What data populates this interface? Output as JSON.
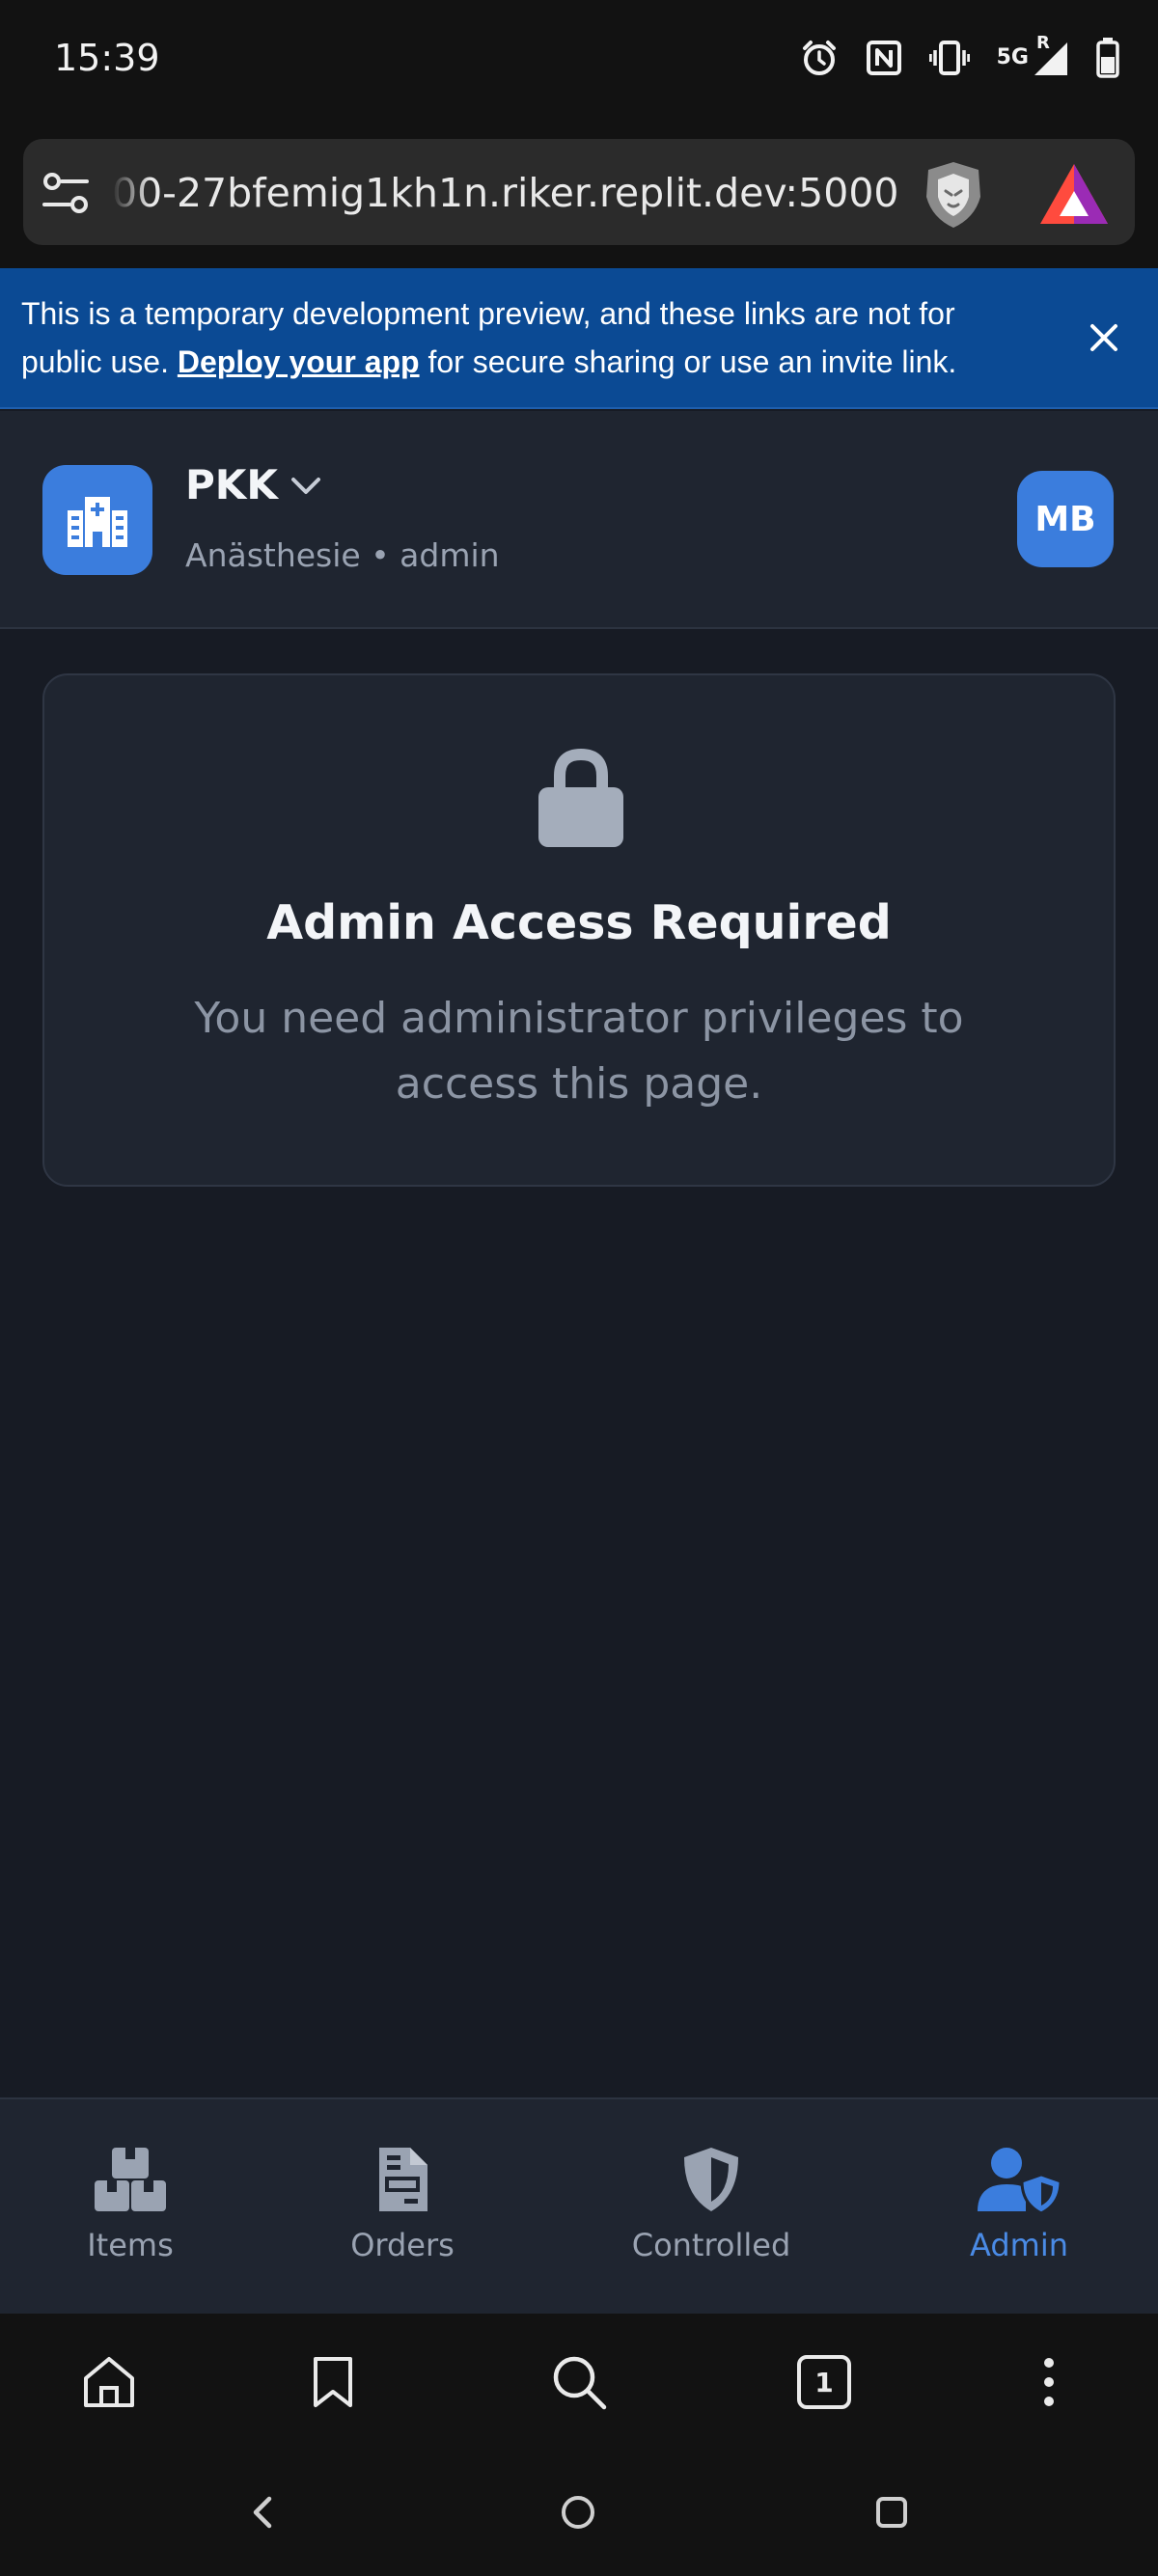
{
  "status_bar": {
    "time": "15:39",
    "network": "5G",
    "roaming": "R",
    "icons": [
      "alarm-icon",
      "nfc-icon",
      "vibrate-icon",
      "signal-icon",
      "battery-icon"
    ]
  },
  "browser": {
    "url": "00-27bfemig1kh1n.riker.replit.dev:5000",
    "icons": [
      "site-settings-icon",
      "brave-shield-icon",
      "bat-rewards-icon"
    ]
  },
  "dev_banner": {
    "text_before": "This is a temporary development preview, and these links are not for public use. ",
    "link": "Deploy your app",
    "text_after": " for secure sharing or use an invite link."
  },
  "header": {
    "hospital_name": "PKK",
    "subtitle": "Anästhesie • admin",
    "avatar_initials": "MB"
  },
  "access_card": {
    "title": "Admin Access Required",
    "message": "You need administrator privileges to access this page."
  },
  "bottom_nav": {
    "items": [
      {
        "label": "Items",
        "icon": "boxes-icon"
      },
      {
        "label": "Orders",
        "icon": "document-icon"
      },
      {
        "label": "Controlled",
        "icon": "shield-icon"
      },
      {
        "label": "Admin",
        "icon": "user-shield-icon"
      }
    ],
    "active": "Admin"
  },
  "browser_toolbar": {
    "tab_count": "1",
    "icons": [
      "home-icon",
      "bookmark-icon",
      "search-icon",
      "tabs-icon",
      "more-icon"
    ]
  },
  "colors": {
    "accent": "#3b7ddd",
    "background": "#171b24",
    "card": "#1f2530",
    "banner": "#0b4a94",
    "active_nav": "#4a8be6"
  }
}
